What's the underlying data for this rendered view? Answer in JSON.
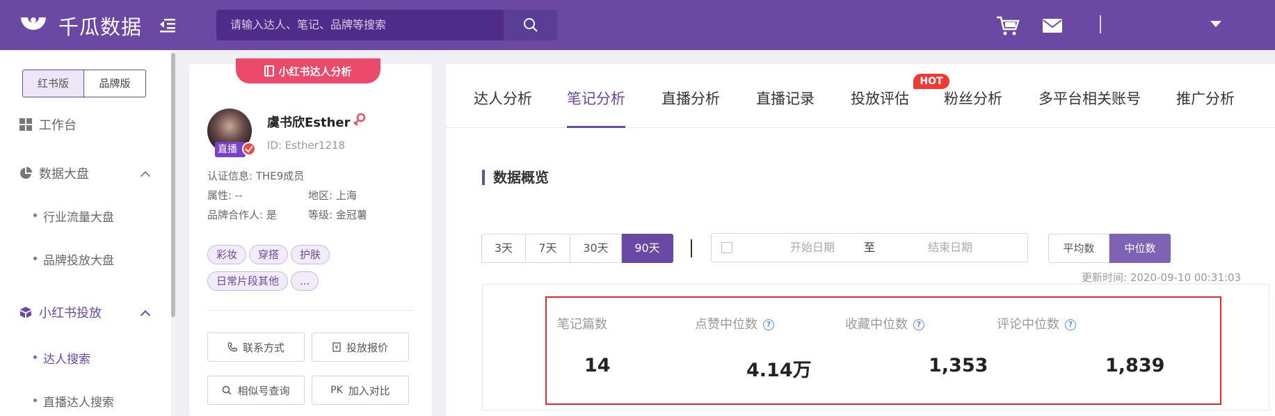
{
  "app": {
    "logo_text": "千瓜数据",
    "search_placeholder": "请输入达人、笔记、品牌等搜索"
  },
  "sidebar": {
    "versions": [
      "红书版",
      "品牌版"
    ],
    "workbench": "工作台",
    "dashboard": "数据大盘",
    "dashboard_items": [
      "行业流量大盘",
      "品牌投放大盘"
    ],
    "xhs_group": "小红书投放",
    "xhs_items": [
      "达人搜索",
      "直播达人搜索"
    ]
  },
  "profile": {
    "ribbon": "小红书达人分析",
    "live_badge": "直播",
    "name": "虞书欣Esther",
    "id": "ID:  Esther1218",
    "cert": "认证信息:  THE9成员",
    "attr": "属性:  --",
    "region": "地区:  上海",
    "partner": "品牌合作人:  是",
    "level": "等级:  金冠薯",
    "tags": [
      "彩妆",
      "穿搭",
      "护肤",
      "日常片段其他",
      "..."
    ],
    "btn_contact": "联系方式",
    "btn_price": "投放报价",
    "btn_similar": "相似号查询",
    "btn_compare_icon": "PK",
    "btn_compare": "加入对比"
  },
  "tabs": [
    "达人分析",
    "笔记分析",
    "直播分析",
    "直播记录",
    "投放评估",
    "粉丝分析",
    "多平台相关账号",
    "推广分析"
  ],
  "hot_badge": "HOT",
  "overview": {
    "title": "数据概览",
    "periods": [
      "3天",
      "7天",
      "30天",
      "90天"
    ],
    "date_start": "开始日期",
    "date_to": "至",
    "date_end": "结束日期",
    "stat_avg": "平均数",
    "stat_median": "中位数",
    "update_time": "更新时间:  2020-09-10 00:31:03",
    "stats": [
      {
        "label": "笔记篇数",
        "value": "14"
      },
      {
        "label": "点赞中位数",
        "value": "4.14万"
      },
      {
        "label": "收藏中位数",
        "value": "1,353"
      },
      {
        "label": "评论中位数",
        "value": "1,839"
      }
    ]
  },
  "colors": {
    "brand": "#6b48a3",
    "highlight": "#e32a2a",
    "ribbon": "#ec4a6a",
    "hot": "#ef3a35"
  }
}
